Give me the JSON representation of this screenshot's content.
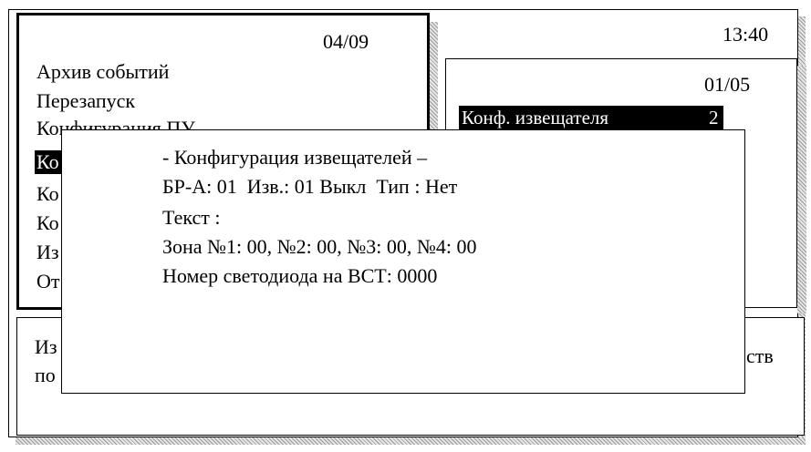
{
  "screen": {
    "time": "13:40",
    "main_menu": {
      "page": "04/09",
      "items": [
        {
          "label": "Архив событий",
          "visible": "Архив событий",
          "selected": false
        },
        {
          "label": "Перезапуск",
          "visible": "Перезапуск",
          "selected": false
        },
        {
          "label": "Конфигурация ПУ",
          "visible": "Конфигурация ПУ",
          "selected": false
        },
        {
          "label": "Ко",
          "visible": "Ко",
          "selected": true
        },
        {
          "label": "Ко",
          "visible": "Ко",
          "selected": false
        },
        {
          "label": "Ко",
          "visible": "Ко",
          "selected": false
        },
        {
          "label": "Из",
          "visible": "Из",
          "selected": false
        },
        {
          "label": "От",
          "visible": "От",
          "selected": false
        }
      ]
    },
    "submenu": {
      "page": "01/05",
      "selected_item": {
        "label": "Конф. извещателя",
        "value": "2"
      }
    },
    "bottom_panel": {
      "line1_start": "Из",
      "line1_end": "ств",
      "line2_start": "по"
    },
    "dialog": {
      "title": "- Конфигурация извещателей –",
      "line_device": "БР-А: 01  Изв.: 01 Выкл  Тип : Нет",
      "line_text": "Текст :",
      "line_zones": "Зона №1: 00, №2: 00, №3: 00, №4: 00",
      "line_led": "Номер светодиода на ВСТ: 0000"
    }
  }
}
